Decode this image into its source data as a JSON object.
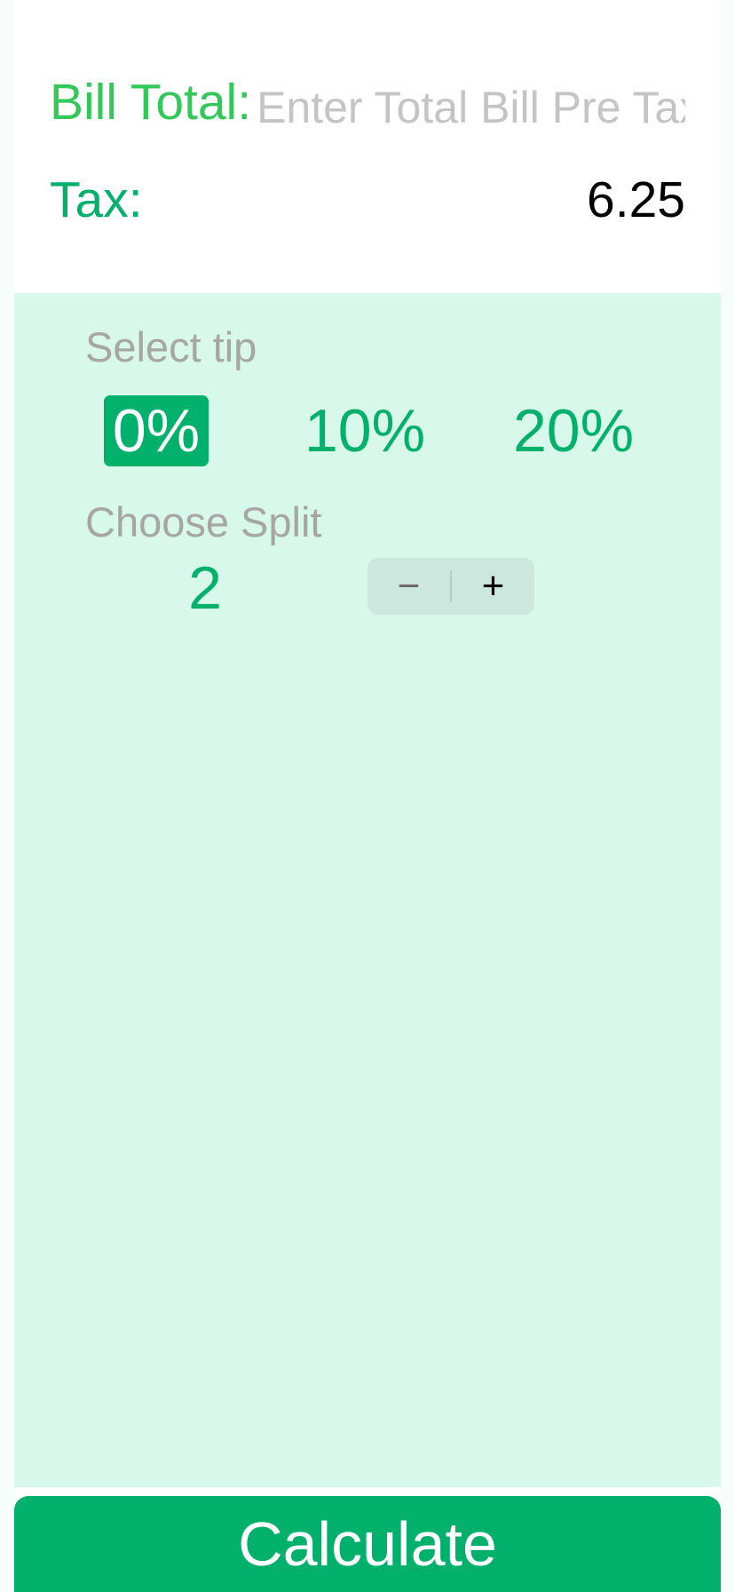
{
  "bill": {
    "label": "Bill Total:",
    "value": "",
    "placeholder": "Enter Total Bill Pre Tax"
  },
  "tax": {
    "label": "Tax:",
    "value": "6.25"
  },
  "tip": {
    "label": "Select tip",
    "options": [
      "0%",
      "10%",
      "20%"
    ],
    "selected": "0%"
  },
  "split": {
    "label": "Choose Split",
    "value": "2",
    "minus_symbol": "−",
    "plus_symbol": "+"
  },
  "calculate": {
    "label": "Calculate"
  },
  "colors": {
    "accent": "#00b06b",
    "label_green": "#34c759",
    "panel_background": "#d7f8ea",
    "stepper_background": "#cbe7de"
  }
}
